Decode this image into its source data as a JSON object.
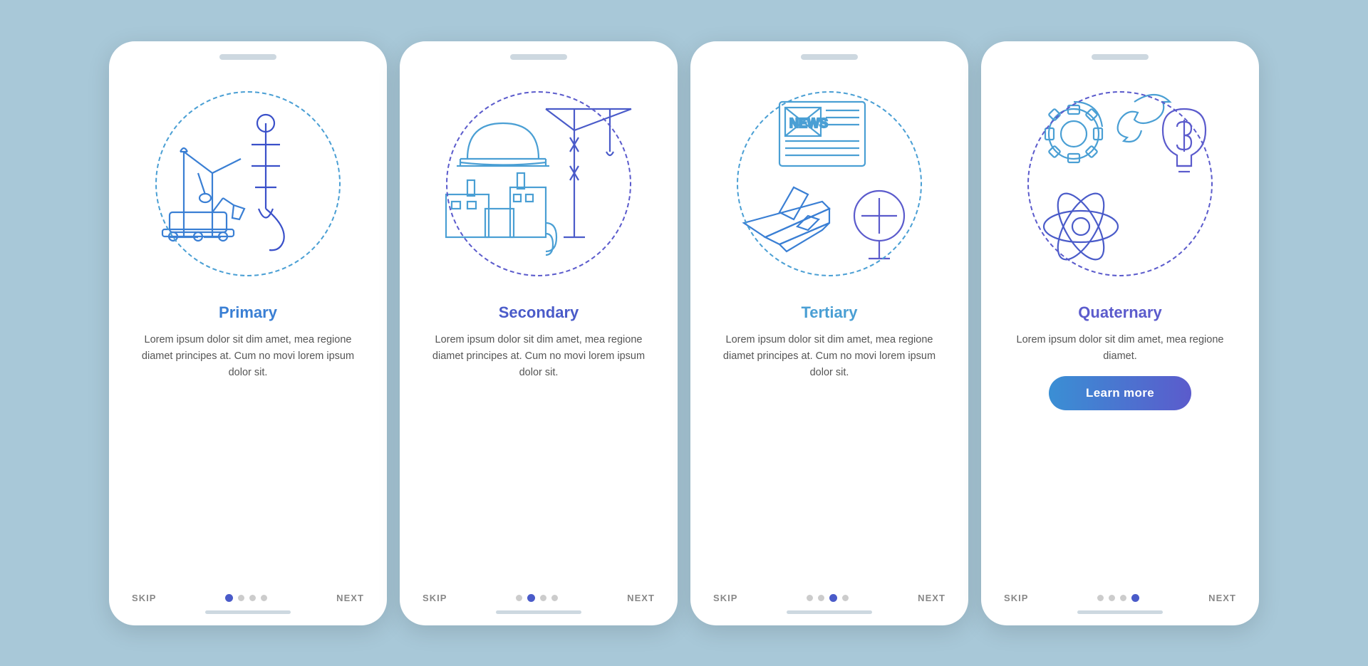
{
  "cards": [
    {
      "id": "primary",
      "title": "Primary",
      "title_class": "primary",
      "body": "Lorem ipsum dolor sit dim amet, mea regione diamet principes at. Cum no movi lorem ipsum dolor sit.",
      "dot_active": 0,
      "has_button": false,
      "circle_class": "blue",
      "skip_label": "SKIP",
      "next_label": "NEXT"
    },
    {
      "id": "secondary",
      "title": "Secondary",
      "title_class": "secondary",
      "body": "Lorem ipsum dolor sit dim amet, mea regione diamet principes at. Cum no movi lorem ipsum dolor sit.",
      "dot_active": 1,
      "has_button": false,
      "circle_class": "indigo",
      "skip_label": "SKIP",
      "next_label": "NEXT"
    },
    {
      "id": "tertiary",
      "title": "Tertiary",
      "title_class": "tertiary",
      "body": "Lorem ipsum dolor sit dim amet, mea regione diamet principes at. Cum no movi lorem ipsum dolor sit.",
      "dot_active": 2,
      "has_button": false,
      "circle_class": "blue",
      "skip_label": "SKIP",
      "next_label": "NEXT"
    },
    {
      "id": "quaternary",
      "title": "Quaternary",
      "title_class": "quaternary",
      "body": "Lorem ipsum dolor sit dim amet, mea regione diamet.",
      "dot_active": 3,
      "has_button": true,
      "button_label": "Learn more",
      "circle_class": "indigo",
      "skip_label": "SKIP",
      "next_label": "NEXT"
    }
  ]
}
